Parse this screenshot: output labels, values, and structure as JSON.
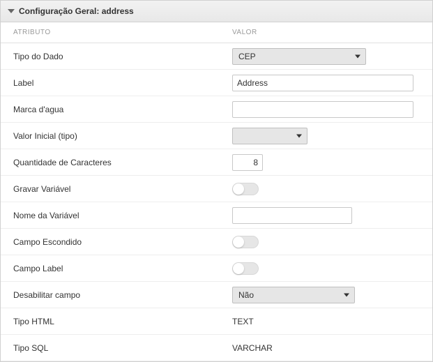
{
  "header": {
    "title": "Configuração Geral: address"
  },
  "columns": {
    "attribute": "ATRIBUTO",
    "value": "VALOR"
  },
  "rows": {
    "data_type": {
      "label": "Tipo do Dado",
      "value": "CEP"
    },
    "label_field": {
      "label": "Label",
      "value": "Address"
    },
    "watermark": {
      "label": "Marca d'agua",
      "value": ""
    },
    "initial_value": {
      "label": "Valor Inicial (tipo)",
      "value": ""
    },
    "max_chars": {
      "label": "Quantidade de Caracteres",
      "value": "8"
    },
    "save_variable": {
      "label": "Gravar Variável",
      "value": false
    },
    "variable_name": {
      "label": "Nome da Variável",
      "value": ""
    },
    "hidden_field": {
      "label": "Campo Escondido",
      "value": false
    },
    "label_field_toggle": {
      "label": "Campo Label",
      "value": false
    },
    "disable_field": {
      "label": "Desabilitar campo",
      "value": "Não"
    },
    "html_type": {
      "label": "Tipo HTML",
      "value": "TEXT"
    },
    "sql_type": {
      "label": "Tipo SQL",
      "value": "VARCHAR"
    }
  }
}
